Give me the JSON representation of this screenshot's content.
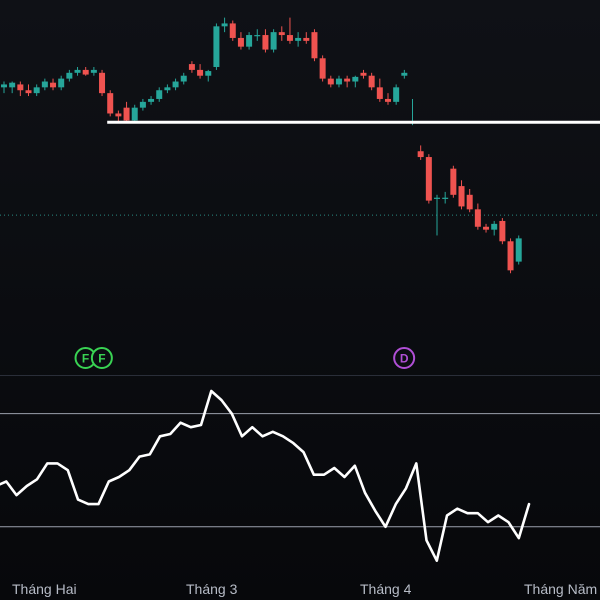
{
  "chart_data": [
    {
      "type": "candlestick",
      "title": "",
      "x_labels": [
        "Tháng Hai",
        "Tháng 3",
        "Tháng 4",
        "Tháng Năm"
      ],
      "price_range": [
        38,
        101
      ],
      "support_level": 81,
      "current_price_level": 65,
      "colors": {
        "up": "#26a69a",
        "down": "#ef5350",
        "support": "#ffffff",
        "price_line": "#2a8a82"
      },
      "candles": [
        {
          "o": 87,
          "h": 88,
          "l": 86,
          "c": 87.5
        },
        {
          "o": 87,
          "h": 88,
          "l": 86,
          "c": 87.8
        },
        {
          "o": 87.5,
          "h": 88,
          "l": 85.5,
          "c": 86.5
        },
        {
          "o": 86.5,
          "h": 87.5,
          "l": 85.5,
          "c": 86
        },
        {
          "o": 86,
          "h": 87.5,
          "l": 85.5,
          "c": 87
        },
        {
          "o": 87,
          "h": 88.5,
          "l": 86.5,
          "c": 88
        },
        {
          "o": 87.8,
          "h": 88.5,
          "l": 86.5,
          "c": 87
        },
        {
          "o": 87,
          "h": 89,
          "l": 86.5,
          "c": 88.5
        },
        {
          "o": 88.5,
          "h": 90,
          "l": 88,
          "c": 89.5
        },
        {
          "o": 89.5,
          "h": 90.5,
          "l": 89,
          "c": 90
        },
        {
          "o": 90,
          "h": 90.5,
          "l": 89,
          "c": 89.2
        },
        {
          "o": 89.5,
          "h": 90.5,
          "l": 89,
          "c": 90
        },
        {
          "o": 89.5,
          "h": 90,
          "l": 85.5,
          "c": 86
        },
        {
          "o": 86,
          "h": 86.5,
          "l": 82,
          "c": 82.5
        },
        {
          "o": 82.5,
          "h": 83,
          "l": 81,
          "c": 82
        },
        {
          "o": 83.5,
          "h": 84.5,
          "l": 81,
          "c": 81.3
        },
        {
          "o": 81.3,
          "h": 84,
          "l": 81,
          "c": 83.5
        },
        {
          "o": 83.5,
          "h": 85,
          "l": 83,
          "c": 84.5
        },
        {
          "o": 84.5,
          "h": 85.5,
          "l": 84,
          "c": 85
        },
        {
          "o": 85,
          "h": 87,
          "l": 84.5,
          "c": 86.5
        },
        {
          "o": 86.5,
          "h": 87.5,
          "l": 86,
          "c": 87
        },
        {
          "o": 87,
          "h": 88.5,
          "l": 86.5,
          "c": 88
        },
        {
          "o": 88,
          "h": 89.5,
          "l": 87.5,
          "c": 89
        },
        {
          "o": 91,
          "h": 91.5,
          "l": 89.5,
          "c": 90
        },
        {
          "o": 90,
          "h": 91,
          "l": 88.5,
          "c": 89
        },
        {
          "o": 89,
          "h": 90,
          "l": 88,
          "c": 89.8
        },
        {
          "o": 90.5,
          "h": 98,
          "l": 90,
          "c": 97.5
        },
        {
          "o": 97.5,
          "h": 99,
          "l": 96.5,
          "c": 98
        },
        {
          "o": 98,
          "h": 98.5,
          "l": 95,
          "c": 95.5
        },
        {
          "o": 95.5,
          "h": 96.5,
          "l": 93.5,
          "c": 94
        },
        {
          "o": 94,
          "h": 96.5,
          "l": 93.5,
          "c": 96
        },
        {
          "o": 96,
          "h": 97,
          "l": 95,
          "c": 96
        },
        {
          "o": 96,
          "h": 97,
          "l": 93,
          "c": 93.5
        },
        {
          "o": 93.5,
          "h": 97,
          "l": 93,
          "c": 96.5
        },
        {
          "o": 96.5,
          "h": 97.5,
          "l": 95,
          "c": 96
        },
        {
          "o": 96,
          "h": 99,
          "l": 94.5,
          "c": 95
        },
        {
          "o": 95,
          "h": 96.5,
          "l": 94,
          "c": 95.5
        },
        {
          "o": 95.5,
          "h": 96.5,
          "l": 94.5,
          "c": 95
        },
        {
          "o": 96.5,
          "h": 97,
          "l": 91.5,
          "c": 92
        },
        {
          "o": 92,
          "h": 92.5,
          "l": 88,
          "c": 88.5
        },
        {
          "o": 88.5,
          "h": 89,
          "l": 87,
          "c": 87.5
        },
        {
          "o": 87.5,
          "h": 89,
          "l": 87,
          "c": 88.5
        },
        {
          "o": 88.5,
          "h": 89,
          "l": 87,
          "c": 88
        },
        {
          "o": 88,
          "h": 89,
          "l": 87,
          "c": 88.8
        },
        {
          "o": 89.5,
          "h": 90,
          "l": 88.5,
          "c": 89
        },
        {
          "o": 89,
          "h": 89.5,
          "l": 86.5,
          "c": 87
        },
        {
          "o": 87,
          "h": 88.5,
          "l": 84.5,
          "c": 85
        },
        {
          "o": 85,
          "h": 86,
          "l": 84,
          "c": 84.5
        },
        {
          "o": 84.5,
          "h": 87.5,
          "l": 84,
          "c": 87
        },
        {
          "o": 89,
          "h": 90,
          "l": 88.5,
          "c": 89.5
        },
        {
          "o": 81,
          "h": 85,
          "l": 80.5,
          "c": 81.2
        },
        {
          "o": 76,
          "h": 77,
          "l": 74.5,
          "c": 75
        },
        {
          "o": 75,
          "h": 75.5,
          "l": 67,
          "c": 67.5
        },
        {
          "o": 68,
          "h": 68.5,
          "l": 61.5,
          "c": 68
        },
        {
          "o": 68,
          "h": 69,
          "l": 67,
          "c": 68
        },
        {
          "o": 73,
          "h": 73.5,
          "l": 68,
          "c": 68.5
        },
        {
          "o": 70,
          "h": 71,
          "l": 66,
          "c": 66.5
        },
        {
          "o": 68.5,
          "h": 69.5,
          "l": 65.5,
          "c": 66
        },
        {
          "o": 66,
          "h": 67,
          "l": 62.5,
          "c": 63
        },
        {
          "o": 63,
          "h": 63.5,
          "l": 62,
          "c": 62.5
        },
        {
          "o": 62.5,
          "h": 64,
          "l": 61.5,
          "c": 63.5
        },
        {
          "o": 64,
          "h": 64.5,
          "l": 60,
          "c": 60.5
        },
        {
          "o": 60.5,
          "h": 61,
          "l": 55,
          "c": 55.5
        },
        {
          "o": 57,
          "h": 61.5,
          "l": 56.5,
          "c": 61
        }
      ],
      "event_markers": [
        {
          "letter": "F",
          "color": "#39d353",
          "candle_index": 9
        },
        {
          "letter": "F",
          "color": "#39d353",
          "candle_index": 11
        },
        {
          "letter": "D",
          "color": "#b04fd6",
          "candle_index": 48
        }
      ]
    },
    {
      "type": "line",
      "title": "",
      "name": "",
      "ylim": [
        10,
        94
      ],
      "reference_lines": [
        80,
        30
      ],
      "values": [
        48,
        50,
        44,
        48,
        51,
        58,
        58,
        55,
        42,
        40,
        40,
        50,
        52,
        55,
        61,
        62,
        70,
        71,
        76,
        74,
        75,
        90,
        86,
        80,
        70,
        74,
        70,
        72,
        70,
        67,
        63,
        53,
        53,
        56,
        52,
        57,
        45,
        37,
        30,
        40,
        47,
        58,
        24,
        15,
        35,
        38,
        36,
        36,
        32,
        35,
        32,
        25,
        40
      ]
    }
  ]
}
